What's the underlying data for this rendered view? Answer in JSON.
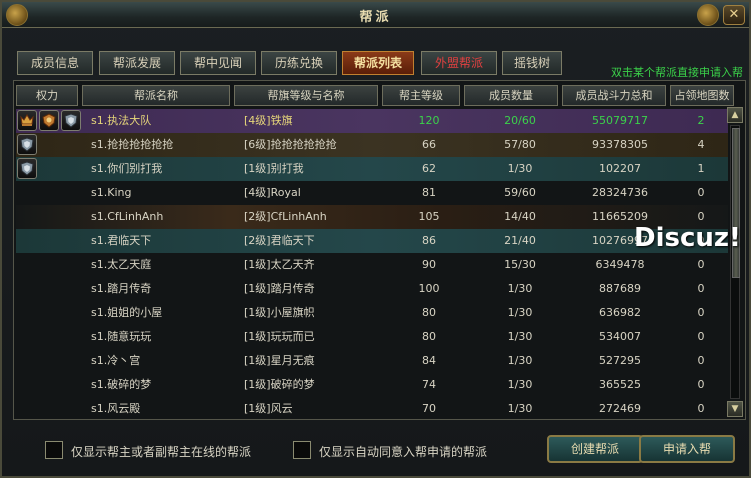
{
  "window": {
    "title": "帮派",
    "close_glyph": "✕"
  },
  "tabs": [
    {
      "label": "成员信息",
      "state": "normal"
    },
    {
      "label": "帮派发展",
      "state": "normal"
    },
    {
      "label": "帮中见闻",
      "state": "normal"
    },
    {
      "label": "历练兑换",
      "state": "normal"
    },
    {
      "label": "帮派列表",
      "state": "active"
    },
    {
      "label": "外盟帮派",
      "state": "red"
    },
    {
      "label": "摇钱树",
      "state": "normal"
    }
  ],
  "hint": "双击某个帮派直接申请入帮",
  "columns": {
    "power": "权力",
    "name": "帮派名称",
    "banner": "帮旗等级与名称",
    "leader_level": "帮主等级",
    "members": "成员数量",
    "combat": "成员战斗力总和",
    "territory": "占领地图数"
  },
  "rows": [
    {
      "badges": [
        "crown-badge-icon",
        "crest-badge-icon",
        "shield-badge-icon"
      ],
      "name": "s1.执法大队",
      "banner": "[4级]铁旗",
      "leader_level": "120",
      "members": "20/60",
      "combat": "55079717",
      "territory": "2"
    },
    {
      "badges": [
        "shield-badge-icon"
      ],
      "name": "s1.抢抢抢抢抢抢",
      "banner": "[6级]抢抢抢抢抢抢",
      "leader_level": "66",
      "members": "57/80",
      "combat": "93378305",
      "territory": "4"
    },
    {
      "badges": [
        "shield-badge-icon"
      ],
      "name": "s1.你们别打我",
      "banner": "[1级]别打我",
      "leader_level": "62",
      "members": "1/30",
      "combat": "102207",
      "territory": "1"
    },
    {
      "badges": [],
      "name": "s1.King",
      "banner": "[4级]Royal",
      "leader_level": "81",
      "members": "59/60",
      "combat": "28324736",
      "territory": "0"
    },
    {
      "badges": [],
      "name": "s1.CfLinhAnh",
      "banner": "[2级]CfLinhAnh",
      "leader_level": "105",
      "members": "14/40",
      "combat": "11665209",
      "territory": "0"
    },
    {
      "badges": [],
      "name": "s1.君临天下",
      "banner": "[2级]君临天下",
      "leader_level": "86",
      "members": "21/40",
      "combat": "10276997",
      "territory": "0"
    },
    {
      "badges": [],
      "name": "s1.太乙天庭",
      "banner": "[1级]太乙天齐",
      "leader_level": "90",
      "members": "15/30",
      "combat": "6349478",
      "territory": "0"
    },
    {
      "badges": [],
      "name": "s1.踏月传奇",
      "banner": "[1级]踏月传奇",
      "leader_level": "100",
      "members": "1/30",
      "combat": "887689",
      "territory": "0"
    },
    {
      "badges": [],
      "name": "s1.姐姐的小屋",
      "banner": "[1级]小屋旗帜",
      "leader_level": "80",
      "members": "1/30",
      "combat": "636982",
      "territory": "0"
    },
    {
      "badges": [],
      "name": "s1.随意玩玩",
      "banner": "[1级]玩玩而已",
      "leader_level": "80",
      "members": "1/30",
      "combat": "534007",
      "territory": "0"
    },
    {
      "badges": [],
      "name": "s1.冷丶宫",
      "banner": "[1级]星月无痕",
      "leader_level": "84",
      "members": "1/30",
      "combat": "527295",
      "territory": "0"
    },
    {
      "badges": [],
      "name": "s1.破碎的梦",
      "banner": "[1级]破碎的梦",
      "leader_level": "74",
      "members": "1/30",
      "combat": "365525",
      "territory": "0"
    },
    {
      "badges": [],
      "name": "s1.风云殿",
      "banner": "[1级]风云",
      "leader_level": "70",
      "members": "1/30",
      "combat": "272469",
      "territory": "0"
    }
  ],
  "watermark": "Discuz!",
  "footer": {
    "filter_online": "仅显示帮主或者副帮主在线的帮派",
    "filter_auto": "仅显示自动同意入帮申请的帮派",
    "create_button": "创建帮派",
    "apply_button": "申请入帮"
  },
  "colors": {
    "highlight_text": "#3bd24a",
    "gold_text": "#e6d67a",
    "active_tab": "#8a3a18"
  }
}
